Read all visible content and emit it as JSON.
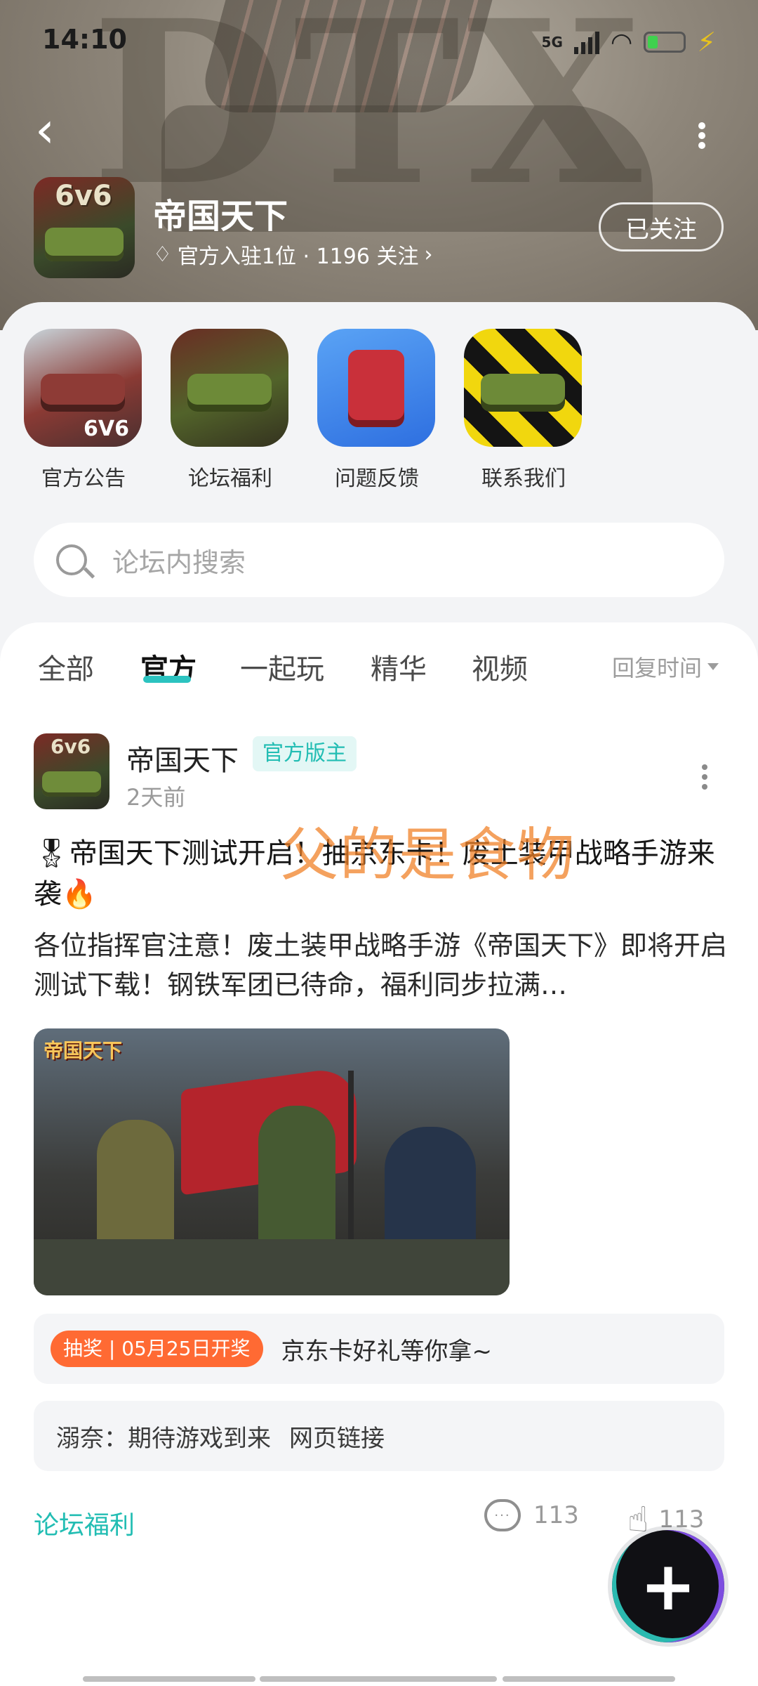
{
  "status_bar": {
    "time": "14:10",
    "network": "5G"
  },
  "header": {
    "forum_name": "帝国天下",
    "meta": "官方入驻1位 · 1196 关注",
    "follow_label": "已关注",
    "avatar_badge": "6v6",
    "watermark": "DTX"
  },
  "shortcuts": [
    {
      "label": "官方公告",
      "icon": "tank-6v6-icon",
      "tag": "6V6"
    },
    {
      "label": "论坛福利",
      "icon": "green-tank-icon"
    },
    {
      "label": "问题反馈",
      "icon": "red-tank-icon"
    },
    {
      "label": "联系我们",
      "icon": "striped-tank-icon"
    }
  ],
  "search": {
    "placeholder": "论坛内搜索"
  },
  "tabs": [
    {
      "label": "全部",
      "active": false
    },
    {
      "label": "官方",
      "active": true
    },
    {
      "label": "一起玩",
      "active": false
    },
    {
      "label": "精华",
      "active": false
    },
    {
      "label": "视频",
      "active": false
    }
  ],
  "sort": {
    "label": "回复时间"
  },
  "post": {
    "author": "帝国天下",
    "badge": "官方版主",
    "time": "2天前",
    "title": "🎖帝国天下测试开启！抽京东卡！废土装甲战略手游来袭🔥",
    "body": "各位指挥官注意！废土装甲战略手游《帝国天下》即将开启测试下载！钢铁军团已待命，福利同步拉满…",
    "image_title": "帝国天下",
    "overlay_text": "父的是食物",
    "lottery_tag": "抽奖 | 05月25日开奖",
    "lottery_text": "京东卡好礼等你拿~",
    "reply_text": "溺奈：期待游戏到来",
    "reply_link": "网页链接",
    "forum_tag": "论坛福利",
    "comments": "113",
    "likes": "113"
  },
  "colors": {
    "accent": "#22bdb3",
    "lottery": "#ff6a33"
  }
}
